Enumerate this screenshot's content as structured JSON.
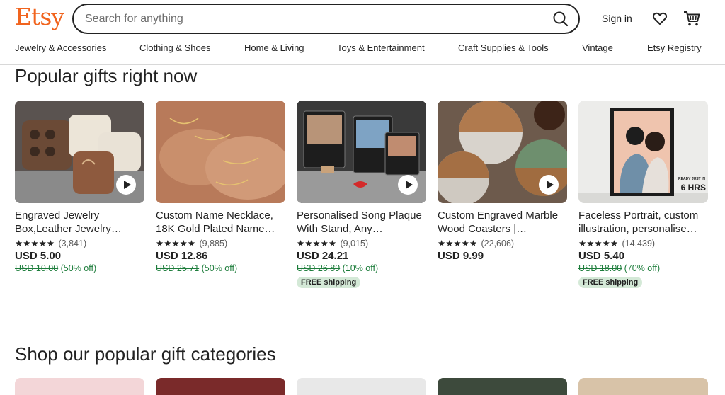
{
  "header": {
    "logo": "Etsy",
    "search_placeholder": "Search for anything",
    "sign_in": "Sign in"
  },
  "nav": [
    "Jewelry & Accessories",
    "Clothing & Shoes",
    "Home & Living",
    "Toys & Entertainment",
    "Craft Supplies & Tools",
    "Vintage",
    "Etsy Registry"
  ],
  "section1": {
    "title": "Popular gifts right now"
  },
  "products": [
    {
      "title": "Engraved Jewelry Box,Leather Jewelry…",
      "stars": "★★★★★",
      "reviews": "(3,841)",
      "price": "USD 5.00",
      "original_price": "USD 10.00",
      "discount": "(50% off)",
      "free_shipping": "",
      "has_video": true
    },
    {
      "title": "Custom Name Necklace, 18K Gold Plated Name…",
      "stars": "★★★★★",
      "reviews": "(9,885)",
      "price": "USD 12.86",
      "original_price": "USD 25.71",
      "discount": "(50% off)",
      "free_shipping": "",
      "has_video": false
    },
    {
      "title": "Personalised Song Plaque With Stand, Any…",
      "stars": "★★★★★",
      "reviews": "(9,015)",
      "price": "USD 24.21",
      "original_price": "USD 26.89",
      "discount": "(10% off)",
      "free_shipping": "FREE shipping",
      "has_video": true
    },
    {
      "title": "Custom Engraved Marble Wood Coasters |…",
      "stars": "★★★★★",
      "reviews": "(22,606)",
      "price": "USD 9.99",
      "original_price": "",
      "discount": "",
      "free_shipping": "",
      "has_video": true
    },
    {
      "title": "Faceless Portrait, custom illustration, personalise…",
      "stars": "★★★★★",
      "reviews": "(14,439)",
      "price": "USD 5.40",
      "original_price": "USD 18.00",
      "discount": "(70% off)",
      "free_shipping": "FREE shipping",
      "has_video": false
    }
  ],
  "product_image_text": {
    "portrait_banner": "READY JUST IN",
    "portrait_hours": "6 HRS"
  },
  "section2": {
    "title": "Shop our popular gift categories"
  },
  "colors": {
    "brand": "#f1641e",
    "sale_green": "#1e7d3c",
    "badge_bg": "#d4e9d7"
  }
}
